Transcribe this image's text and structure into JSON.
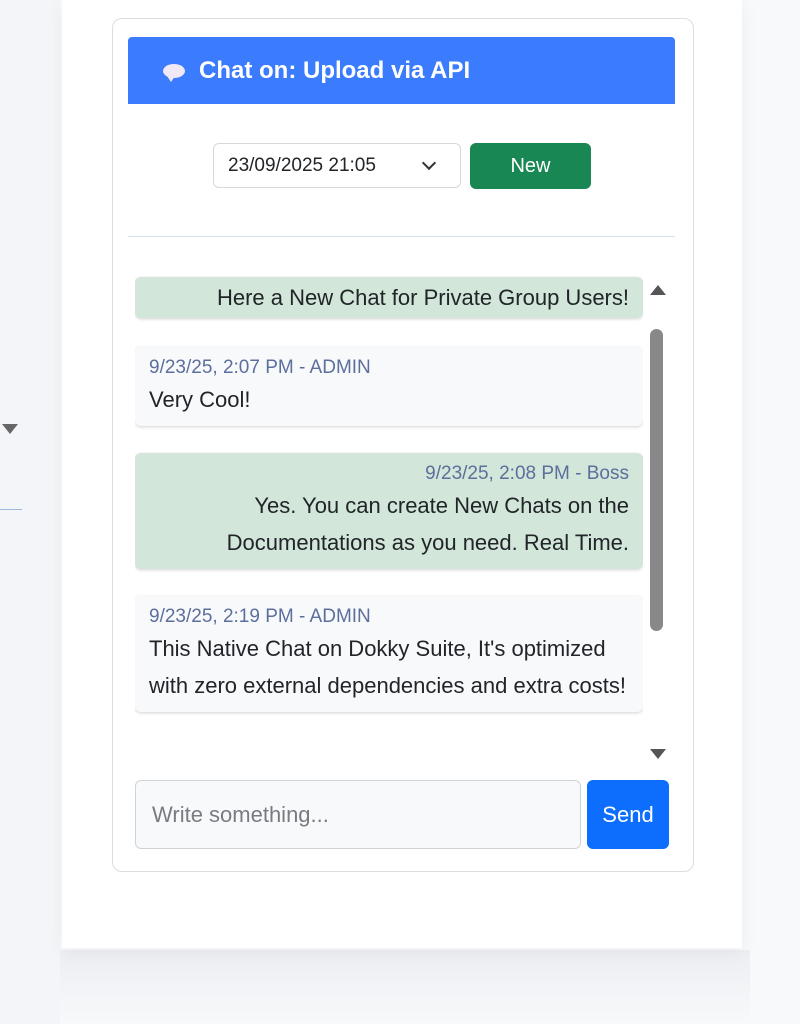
{
  "header": {
    "title": "Chat on: Upload via API",
    "icon": "chat-bubble-icon"
  },
  "session": {
    "selected": "23/09/2025 21:05",
    "new_label": "New"
  },
  "messages": [
    {
      "author": "",
      "meta": "",
      "text": "Here a New Chat for Private Group Users!",
      "side": "right"
    },
    {
      "author": "ADMIN",
      "meta": "9/23/25, 2:07 PM - ADMIN",
      "text": "Very Cool!",
      "side": "left"
    },
    {
      "author": "Boss",
      "meta": "9/23/25, 2:08 PM - Boss",
      "text": "Yes. You can create New Chats on the Documentations as you need. Real Time.",
      "side": "right"
    },
    {
      "author": "ADMIN",
      "meta": "9/23/25, 2:19 PM - ADMIN",
      "text": "This Native Chat on Dokky Suite, It's optimized with zero external dependencies and extra costs!",
      "side": "left"
    }
  ],
  "composer": {
    "placeholder": "Write something...",
    "send_label": "Send"
  },
  "colors": {
    "header_bg": "#3b7bfd",
    "new_button": "#198754",
    "send_button": "#0d6efd",
    "own_message_bg": "#d2e6d9",
    "other_message_bg": "#f8f9fb",
    "meta_text": "#5c6f9c"
  }
}
